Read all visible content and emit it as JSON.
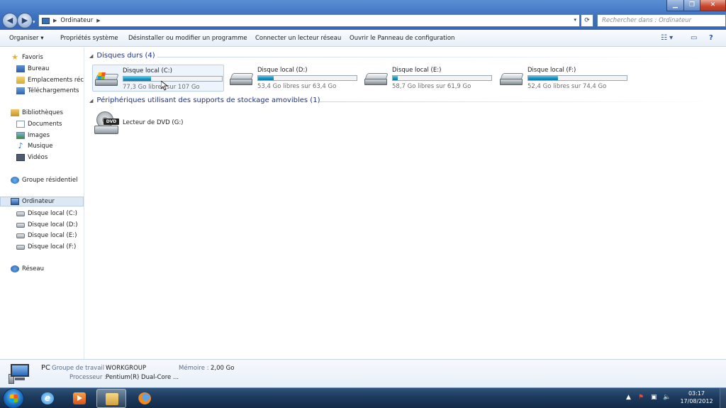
{
  "address": {
    "crumb": "Ordinateur",
    "search_placeholder": "Rechercher dans : Ordinateur"
  },
  "toolbar": {
    "organize": "Organiser ▾",
    "items": [
      "Propriétés système",
      "Désinstaller ou modifier un programme",
      "Connecter un lecteur réseau",
      "Ouvrir le Panneau de configuration"
    ]
  },
  "nav": {
    "favorites": "Favoris",
    "fav_items": [
      "Bureau",
      "Emplacements récents",
      "Téléchargements"
    ],
    "libraries": "Bibliothèques",
    "lib_items": [
      "Documents",
      "Images",
      "Musique",
      "Vidéos"
    ],
    "homegroup": "Groupe résidentiel",
    "computer": "Ordinateur",
    "drives": [
      "Disque local (C:)",
      "Disque local  (D:)",
      "Disque local  (E:)",
      "Disque local (F:)"
    ],
    "network": "Réseau"
  },
  "content": {
    "hdd_group": "Disques durs (4)",
    "removable_group": "Périphériques utilisant des supports de stockage amovibles (1)",
    "drives": [
      {
        "name": "Disque local (C:)",
        "info": "77,3 Go libres sur 107 Go",
        "used": 0.28
      },
      {
        "name": "Disque local  (D:)",
        "info": "53,4 Go libres sur 63,4 Go",
        "used": 0.16
      },
      {
        "name": "Disque local  (E:)",
        "info": "58,7 Go libres sur 61,9 Go",
        "used": 0.05
      },
      {
        "name": "Disque local (F:)",
        "info": "52,4 Go libres sur 74,4 Go",
        "used": 0.3
      }
    ],
    "dvd": {
      "name": "Lecteur de DVD (G:)",
      "badge": "DVD"
    }
  },
  "details": {
    "pc_label": "PC",
    "workgroup_key": "Groupe de travail :",
    "workgroup_val": "WORKGROUP",
    "memory_key": "Mémoire :",
    "memory_val": "2,00 Go",
    "cpu_key": "Processeur :",
    "cpu_val": "Pentium(R) Dual-Core ..."
  },
  "taskbar": {
    "time": "03:17",
    "date": "17/08/2012",
    "ie_glyph": "e"
  }
}
